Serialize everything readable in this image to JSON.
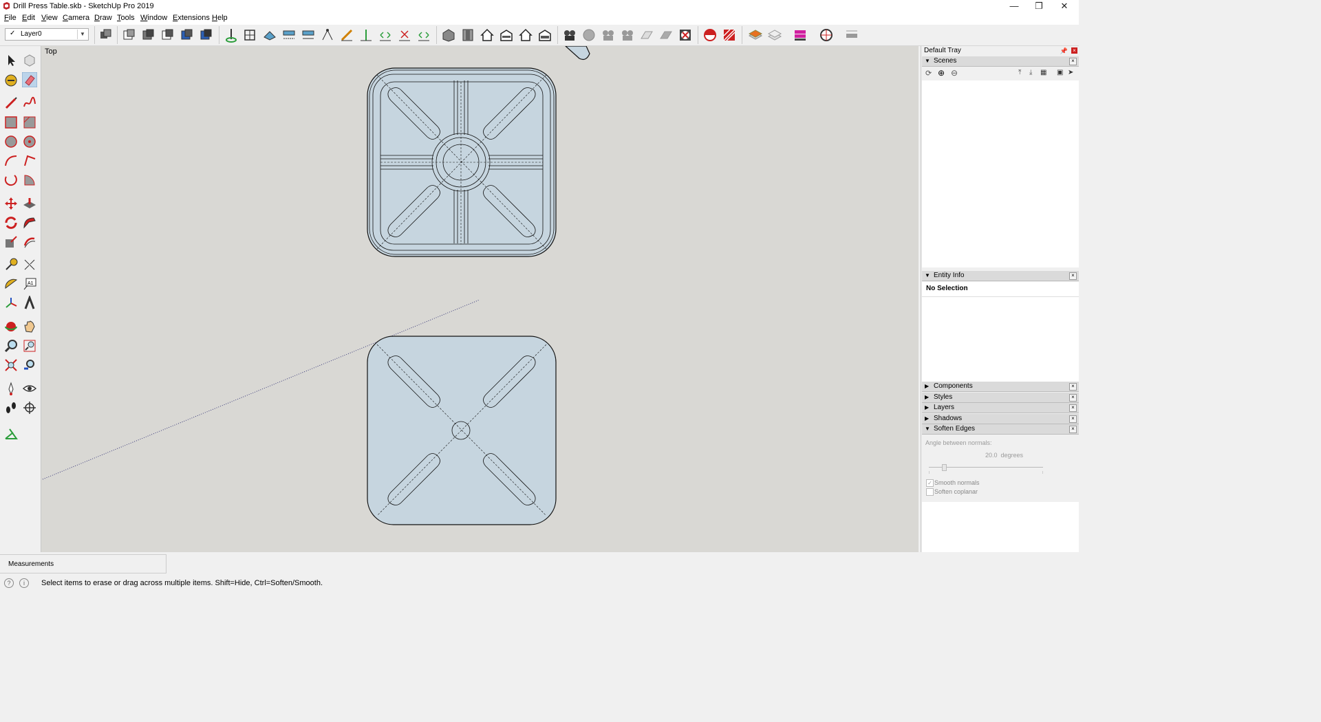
{
  "window": {
    "title": "Drill Press Table.skb - SketchUp Pro 2019",
    "minimize": "—",
    "restore": "❐",
    "close": "✕"
  },
  "menu": [
    {
      "label": "File",
      "accel": "F",
      "rest": "ile"
    },
    {
      "label": "Edit",
      "accel": "E",
      "rest": "dit"
    },
    {
      "label": "View",
      "accel": "V",
      "rest": "iew"
    },
    {
      "label": "Camera",
      "accel": "C",
      "rest": "amera"
    },
    {
      "label": "Draw",
      "accel": "D",
      "rest": "raw"
    },
    {
      "label": "Tools",
      "accel": "T",
      "rest": "ools"
    },
    {
      "label": "Window",
      "accel": "W",
      "rest": "indow"
    },
    {
      "label": "Extensions",
      "accel": "E",
      "rest": "xtensions"
    },
    {
      "label": "Help",
      "accel": "H",
      "rest": "elp"
    }
  ],
  "toolbar": {
    "layer_check": "✓",
    "layer_value": "Layer0",
    "layer_arrow": "▼"
  },
  "viewport": {
    "view_name": "Top"
  },
  "tray": {
    "title": "Default Tray",
    "scenes": {
      "label": "Scenes",
      "arrow": "▼",
      "close": "×"
    },
    "entity_info": {
      "label": "Entity Info",
      "arrow": "▼",
      "close": "×",
      "selection": "No Selection"
    },
    "collapsed_panels": [
      {
        "label": "Components",
        "arrow": "▶",
        "close": "×"
      },
      {
        "label": "Styles",
        "arrow": "▶",
        "close": "×"
      },
      {
        "label": "Layers",
        "arrow": "▶",
        "close": "×"
      },
      {
        "label": "Shadows",
        "arrow": "▶",
        "close": "×"
      }
    ],
    "soften_edges": {
      "label": "Soften Edges",
      "arrow": "▼",
      "close": "×",
      "angle_label": "Angle between normals:",
      "angle_value": "20.0  degrees",
      "slider_fraction": 0.12,
      "smooth_normals_label": "Smooth normals",
      "smooth_normals_checked": true,
      "soften_coplanar_label": "Soften coplanar",
      "soften_coplanar_checked": false
    }
  },
  "measurements": {
    "label": "Measurements"
  },
  "status": {
    "text": "Select items to erase or drag across multiple items. Shift=Hide, Ctrl=Soften/Smooth."
  },
  "colors": {
    "viewport_bg": "#d9d8d4",
    "model_fill": "#c6d5df",
    "accent_red": "#cc2020"
  }
}
